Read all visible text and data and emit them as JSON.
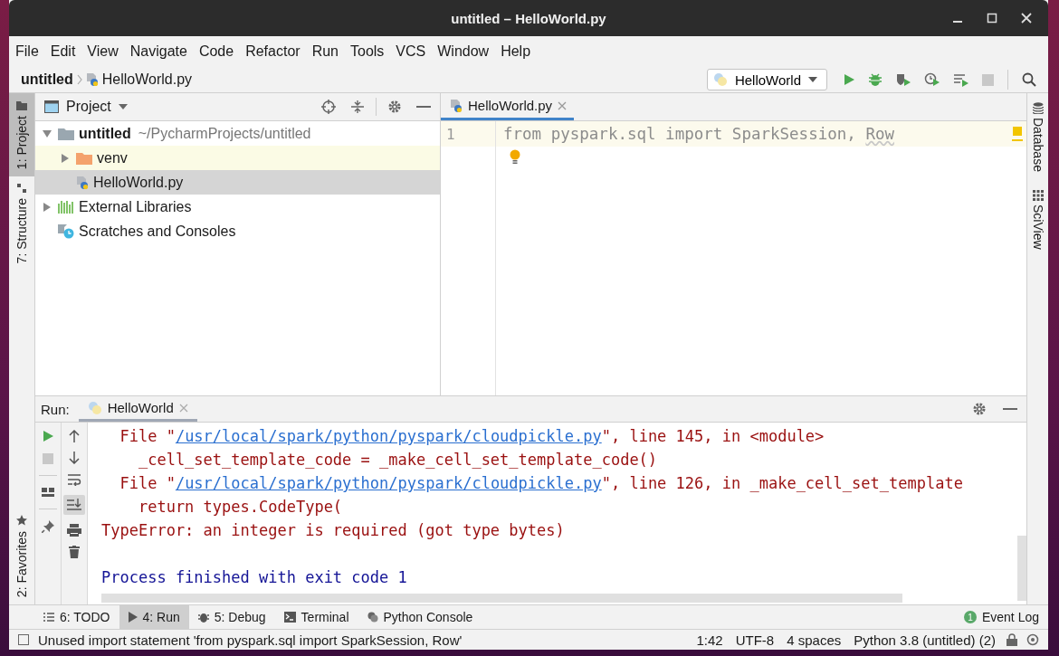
{
  "window": {
    "title": "untitled – HelloWorld.py"
  },
  "menu": [
    "File",
    "Edit",
    "View",
    "Navigate",
    "Code",
    "Refactor",
    "Run",
    "Tools",
    "VCS",
    "Window",
    "Help"
  ],
  "breadcrumbs": [
    "untitled",
    "HelloWorld.py"
  ],
  "run_config": {
    "label": "HelloWorld"
  },
  "left_tools_top": [
    {
      "label": "1: Project",
      "selected": true
    },
    {
      "label": "7: Structure",
      "selected": false
    }
  ],
  "left_tools_bottom": [
    {
      "label": "2: Favorites",
      "selected": false
    }
  ],
  "project_panel": {
    "title": "Project",
    "tree": [
      {
        "label": "untitled",
        "detail": "~/PycharmProjects/untitled",
        "kind": "root",
        "expanded": true,
        "selected": false,
        "highlighted": false,
        "children": [
          {
            "label": "venv",
            "kind": "folder",
            "expanded": false,
            "selected": false,
            "highlighted": true
          },
          {
            "label": "HelloWorld.py",
            "kind": "python",
            "selected": true,
            "highlighted": false
          }
        ]
      },
      {
        "label": "External Libraries",
        "kind": "library",
        "expanded": false,
        "selected": false,
        "highlighted": false
      },
      {
        "label": "Scratches and Consoles",
        "kind": "scratches",
        "selected": false,
        "highlighted": false
      }
    ]
  },
  "editor": {
    "tabs": [
      {
        "label": "HelloWorld.py",
        "selected": true
      }
    ],
    "lines": [
      {
        "number": "1",
        "parts": [
          {
            "text": "from pyspark.sql import SparkSession, ",
            "warning": false
          },
          {
            "text": "Row",
            "warning": true
          }
        ]
      }
    ]
  },
  "right_tools": [
    {
      "label": "Database",
      "kind": "database"
    },
    {
      "label": "SciView",
      "kind": "grid"
    }
  ],
  "run_panel": {
    "label": "Run:",
    "tabs": [
      {
        "label": "HelloWorld",
        "selected": true
      }
    ],
    "lines": [
      {
        "kind": "error",
        "parts": [
          {
            "text": "  File \"",
            "link": false
          },
          {
            "text": "/usr/local/spark/python/pyspark/cloudpickle.py",
            "link": true
          },
          {
            "text": "\", line 145, in <module>",
            "link": false
          }
        ]
      },
      {
        "kind": "error",
        "parts": [
          {
            "text": "    _cell_set_template_code = _make_cell_set_template_code()",
            "link": false
          }
        ]
      },
      {
        "kind": "error",
        "parts": [
          {
            "text": "  File \"",
            "link": false
          },
          {
            "text": "/usr/local/spark/python/pyspark/cloudpickle.py",
            "link": true
          },
          {
            "text": "\", line 126, in _make_cell_set_template",
            "link": false
          }
        ]
      },
      {
        "kind": "error",
        "parts": [
          {
            "text": "    return types.CodeType(",
            "link": false
          }
        ]
      },
      {
        "kind": "error",
        "parts": [
          {
            "text": "TypeError: an integer is required (got type bytes)",
            "link": false
          }
        ]
      },
      {
        "kind": "blank"
      },
      {
        "kind": "info",
        "parts": [
          {
            "text": "Process finished with exit code 1",
            "link": false
          }
        ]
      }
    ]
  },
  "bottom_tabs": [
    {
      "label": "6: TODO",
      "kind": "list",
      "selected": false
    },
    {
      "label": "4: Run",
      "kind": "run",
      "selected": true
    },
    {
      "label": "5: Debug",
      "kind": "debug",
      "selected": false
    },
    {
      "label": "Terminal",
      "kind": "terminal",
      "selected": false
    },
    {
      "label": "Python Console",
      "kind": "python",
      "selected": false
    }
  ],
  "event_log": {
    "label": "Event Log",
    "count": "1"
  },
  "status_bar": {
    "message": "Unused import statement 'from pyspark.sql import SparkSession, Row'",
    "position": "1:42",
    "encoding": "UTF-8",
    "indent": "4 spaces",
    "interpreter": "Python 3.8 (untitled) (2)"
  }
}
